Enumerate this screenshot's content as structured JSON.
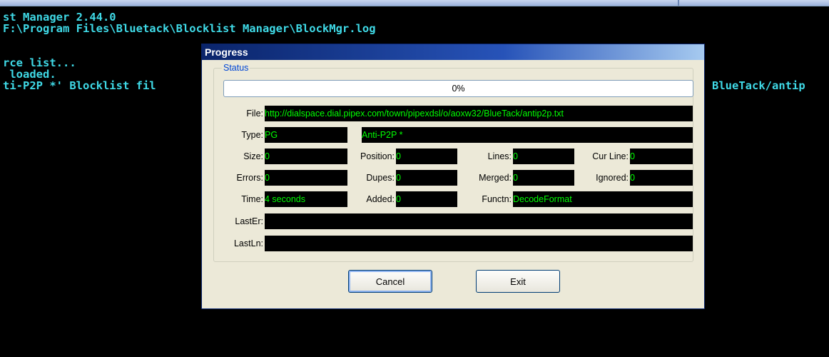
{
  "console": {
    "lines": [
      "st Manager 2.44.0",
      "F:\\Program Files\\Bluetack\\Blocklist Manager\\BlockMgr.log",
      "",
      "rce list...",
      " loaded.",
      "ti-P2P *' Blocklist fil",
      "BlueTack/antip"
    ]
  },
  "dialog": {
    "title": "Progress",
    "group_label": "Status",
    "progress": {
      "percent_text": "0%",
      "value": 0
    },
    "labels": {
      "file": "File:",
      "type": "Type:",
      "size": "Size:",
      "position": "Position:",
      "lines": "Lines:",
      "cur_line": "Cur Line:",
      "errors": "Errors:",
      "dupes": "Dupes:",
      "merged": "Merged:",
      "ignored": "Ignored:",
      "time": "Time:",
      "added": "Added:",
      "functn": "Functn:",
      "last_er": "LastEr:",
      "last_ln": "LastLn:"
    },
    "values": {
      "file": "http://dialspace.dial.pipex.com/town/pipexdsl/o/aoxw32/BlueTack/antip2p.txt",
      "type": "PG",
      "type_name": "Anti-P2P *",
      "size": "0",
      "position": "0",
      "lines": "0",
      "cur_line": "0",
      "errors": "0",
      "dupes": "0",
      "merged": "0",
      "ignored": "0",
      "time": "4 seconds",
      "added": "0",
      "functn": "DecodeFormat",
      "last_er": "",
      "last_ln": ""
    },
    "buttons": {
      "cancel": "Cancel",
      "exit": "Exit"
    }
  }
}
